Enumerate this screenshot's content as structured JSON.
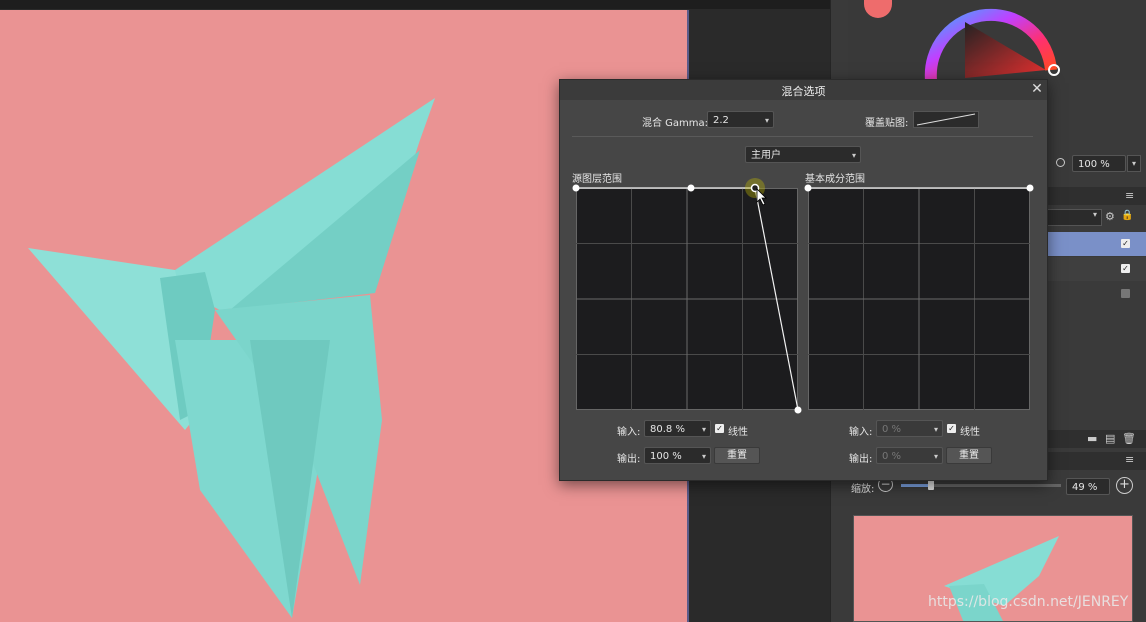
{
  "dialog": {
    "title": "混合选项",
    "close_glyph": "✕",
    "blend_gamma": {
      "label": "混合 Gamma:",
      "value": "2.2"
    },
    "overlay_label": "覆盖贴图:",
    "channel_select": {
      "value": "主用户"
    },
    "source_range": {
      "label": "源图层范围",
      "input_label": "输入:",
      "input_value": "80.8 %",
      "output_label": "输出:",
      "output_value": "100 %",
      "linear_label": "线性",
      "linear_checked": true,
      "reset_label": "重置"
    },
    "base_range": {
      "label": "基本成分范围",
      "input_label": "输入:",
      "input_value": "0 %",
      "output_label": "输出:",
      "output_value": "0 %",
      "linear_label": "线性",
      "linear_checked": true,
      "reset_label": "重置"
    }
  },
  "right_panel": {
    "opacity_value": "100 %",
    "zoom_label": "缩放:",
    "zoom_value": "49 %",
    "current_color": "#ee6c6c"
  },
  "document": {
    "background_color": "#ea9393",
    "butterfly_color": "#7fd8cf"
  },
  "watermark": "https://blog.csdn.net/JENREY"
}
